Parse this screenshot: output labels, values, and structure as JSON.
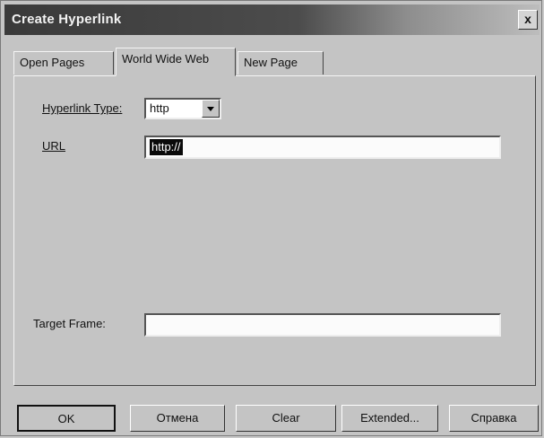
{
  "window": {
    "title": "Create Hyperlink",
    "close_label": "x"
  },
  "tabs": [
    {
      "label": "Open Pages"
    },
    {
      "label": "World Wide Web"
    },
    {
      "label": "New Page"
    }
  ],
  "form": {
    "hyperlink_type_label": "Hyperlink Type:",
    "hyperlink_type_value": "http",
    "url_label": "URL",
    "url_value": "http://",
    "target_frame_label": "Target Frame:",
    "target_frame_value": ""
  },
  "buttons": {
    "ok": "OK",
    "cancel": "Отмена",
    "clear": "Clear",
    "extended": "Extended...",
    "help": "Справка"
  }
}
